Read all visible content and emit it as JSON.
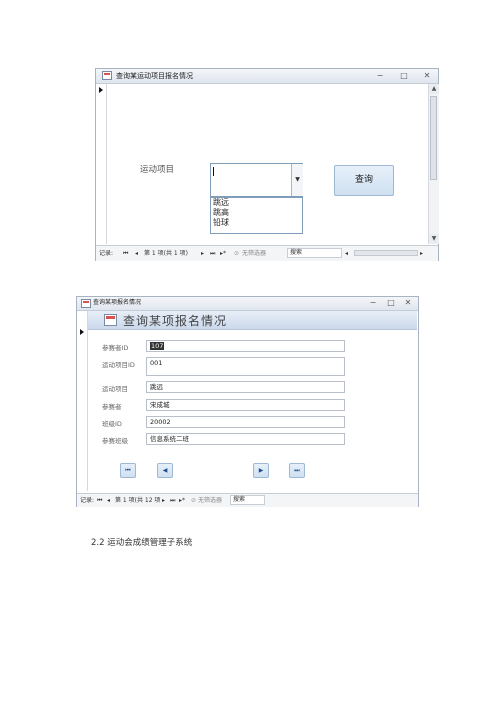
{
  "window1": {
    "title": "查询某运动项目报名情况",
    "controls": [
      "−",
      "□",
      "✕"
    ],
    "field_label": "运动项目",
    "combo_value": "",
    "dropdown_arrow": "▼",
    "options": [
      "跳远",
      "跳高",
      "铅球"
    ],
    "query_button": "查询",
    "nav": {
      "record_label": "记录:",
      "first": "⏮",
      "prev": "◂",
      "position": "第 1 项(共 1 项)",
      "next": "▸",
      "last": "⏭",
      "new": "▸*",
      "filter": "无筛选器",
      "search": "搜索"
    }
  },
  "window2": {
    "title": "查询某项报名情况",
    "controls": [
      "−",
      "□",
      "✕"
    ],
    "header_title": "查询某项报名情况",
    "fields": [
      {
        "label": "参赛者ID",
        "value": "107"
      },
      {
        "label": "运动项目ID",
        "value": "001"
      },
      {
        "label": "运动项目",
        "value": "跳远"
      },
      {
        "label": "参赛者",
        "value": "宋成城"
      },
      {
        "label": "班级ID",
        "value": "20002"
      },
      {
        "label": "参赛班级",
        "value": "信息系统二班"
      }
    ],
    "nav_buttons": [
      "⏮",
      "◀",
      "▶",
      "⏭"
    ],
    "nav": {
      "record_label": "记录:",
      "first": "⏮",
      "prev": "◂",
      "position": "第 1 项(共 12 项",
      "next": "▸",
      "last": "⏭",
      "new": "▸*",
      "filter": "无筛选器",
      "search": "搜索"
    }
  },
  "caption": "2.2 运动会成绩管理子系统"
}
